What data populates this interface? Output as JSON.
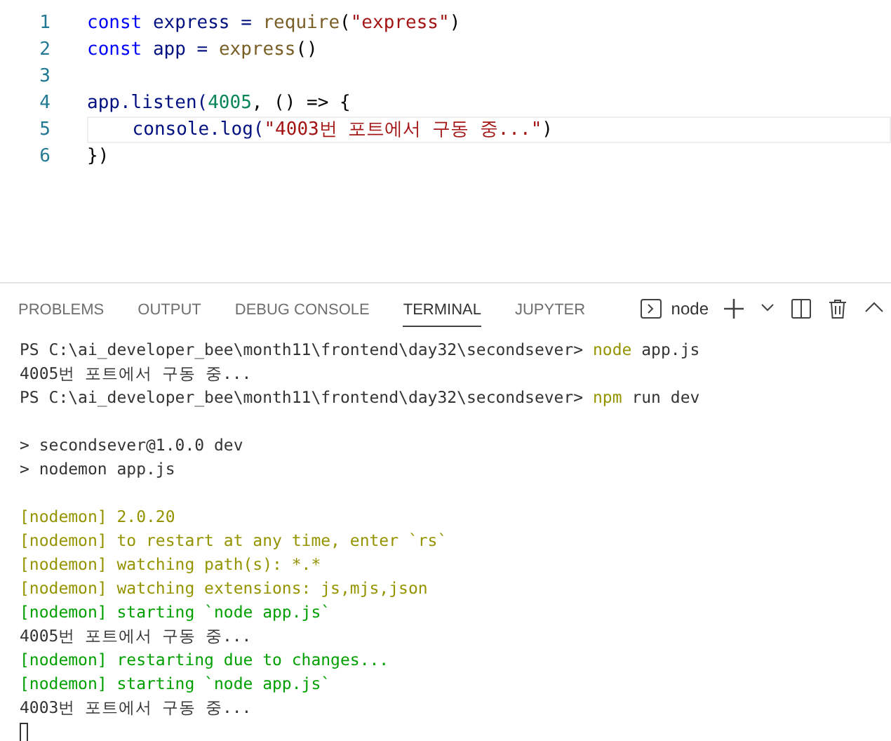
{
  "editor": {
    "lines": [
      {
        "number": "1",
        "current": false,
        "tokens": [
          {
            "kind": "keyword",
            "text": "const"
          },
          {
            "kind": "variable",
            "text": " express = "
          },
          {
            "kind": "function",
            "text": "require"
          },
          {
            "kind": "plain",
            "text": "("
          },
          {
            "kind": "string",
            "text": "\"express\""
          },
          {
            "kind": "plain",
            "text": ")"
          }
        ]
      },
      {
        "number": "2",
        "current": false,
        "tokens": [
          {
            "kind": "keyword",
            "text": "const"
          },
          {
            "kind": "variable",
            "text": " app = "
          },
          {
            "kind": "function",
            "text": "express"
          },
          {
            "kind": "plain",
            "text": "()"
          }
        ]
      },
      {
        "number": "3",
        "current": false
      },
      {
        "number": "4",
        "current": false,
        "tokens": [
          {
            "kind": "variable",
            "text": "app.listen("
          },
          {
            "kind": "number",
            "text": "4005"
          },
          {
            "kind": "plain",
            "text": ", () => {"
          }
        ]
      },
      {
        "number": "5",
        "current": true,
        "tokens": [
          {
            "kind": "variable",
            "text": "    console.log("
          },
          {
            "kind": "string",
            "text": "\"4003번 포트에서 구동 중...\""
          },
          {
            "kind": "plain",
            "text": ")"
          }
        ]
      },
      {
        "number": "6",
        "current": false,
        "tokens": [
          {
            "kind": "plain",
            "text": "})"
          }
        ]
      }
    ]
  },
  "panel": {
    "tabs": [
      {
        "label": "PROBLEMS",
        "selected": false
      },
      {
        "label": "OUTPUT",
        "selected": false
      },
      {
        "label": "DEBUG CONSOLE",
        "selected": false
      },
      {
        "label": "TERMINAL",
        "selected": true
      },
      {
        "label": "JUPYTER",
        "selected": false
      }
    ],
    "shell": "node"
  },
  "terminal": {
    "lines": [
      {
        "kind": "text",
        "segments": [
          {
            "kind": "plain",
            "text": "PS C:\\ai_developer_bee\\month11\\frontend\\day32\\secondsever> "
          },
          {
            "kind": "command",
            "text": "node"
          },
          {
            "kind": "plain",
            "text": " app.js"
          }
        ]
      },
      {
        "kind": "text",
        "segments": [
          {
            "kind": "plain",
            "text": "4005번 포트에서 구동 중..."
          }
        ]
      },
      {
        "kind": "text",
        "segments": [
          {
            "kind": "plain",
            "text": "PS C:\\ai_developer_bee\\month11\\frontend\\day32\\secondsever> "
          },
          {
            "kind": "command",
            "text": "npm"
          },
          {
            "kind": "plain",
            "text": " run dev"
          }
        ]
      },
      {
        "kind": "blank"
      },
      {
        "kind": "text",
        "segments": [
          {
            "kind": "plain",
            "text": "> secondsever@1.0.0 dev"
          }
        ]
      },
      {
        "kind": "text",
        "segments": [
          {
            "kind": "plain",
            "text": "> nodemon app.js"
          }
        ]
      },
      {
        "kind": "blank"
      },
      {
        "kind": "text",
        "segments": [
          {
            "kind": "warn",
            "text": "[nodemon] 2.0.20"
          }
        ]
      },
      {
        "kind": "text",
        "segments": [
          {
            "kind": "warn",
            "text": "[nodemon] to restart at any time, enter `rs`"
          }
        ]
      },
      {
        "kind": "text",
        "segments": [
          {
            "kind": "warn",
            "text": "[nodemon] watching path(s): *.*"
          }
        ]
      },
      {
        "kind": "text",
        "segments": [
          {
            "kind": "warn",
            "text": "[nodemon] watching extensions: js,mjs,json"
          }
        ]
      },
      {
        "kind": "text",
        "segments": [
          {
            "kind": "ok",
            "text": "[nodemon] starting `node app.js`"
          }
        ]
      },
      {
        "kind": "text",
        "segments": [
          {
            "kind": "plain",
            "text": "4005번 포트에서 구동 중..."
          }
        ]
      },
      {
        "kind": "text",
        "segments": [
          {
            "kind": "ok",
            "text": "[nodemon] restarting due to changes..."
          }
        ]
      },
      {
        "kind": "text",
        "segments": [
          {
            "kind": "ok",
            "text": "[nodemon] starting `node app.js`"
          }
        ]
      },
      {
        "kind": "text",
        "segments": [
          {
            "kind": "plain",
            "text": "4003번 포트에서 구동 중..."
          }
        ]
      },
      {
        "kind": "cursor"
      }
    ]
  }
}
